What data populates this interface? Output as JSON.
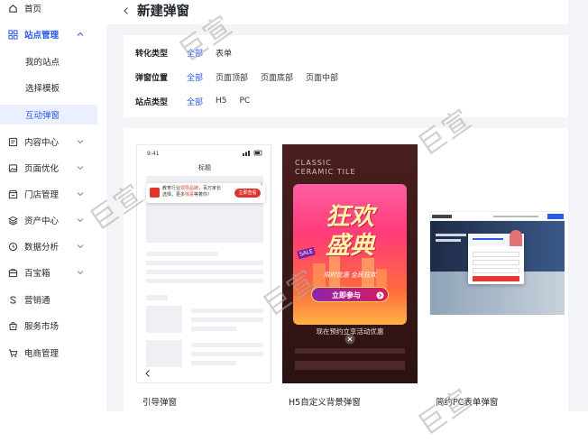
{
  "sidebar": {
    "items": [
      {
        "label": "首页",
        "icon": "home-icon"
      },
      {
        "label": "站点管理",
        "icon": "grid-icon"
      },
      {
        "label": "内容中心",
        "icon": "content-icon"
      },
      {
        "label": "页面优化",
        "icon": "image-icon"
      },
      {
        "label": "门店管理",
        "icon": "store-icon"
      },
      {
        "label": "资产中心",
        "icon": "layers-icon"
      },
      {
        "label": "数据分析",
        "icon": "clock-icon"
      },
      {
        "label": "百宝箱",
        "icon": "toolbox-icon"
      },
      {
        "label": "营销通",
        "icon": "marketing-icon"
      },
      {
        "label": "服务市场",
        "icon": "bag-icon"
      },
      {
        "label": "电商管理",
        "icon": "cart-icon"
      }
    ],
    "sub_items": [
      {
        "label": "我的站点"
      },
      {
        "label": "选择模板"
      },
      {
        "label": "互动弹窗"
      }
    ]
  },
  "header": {
    "title": "新建弹窗"
  },
  "filters": {
    "conversion": {
      "label": "转化类型",
      "options": [
        "全部",
        "表单"
      ]
    },
    "position": {
      "label": "弹窗位置",
      "options": [
        "全部",
        "页面顶部",
        "页面底部",
        "页面中部"
      ]
    },
    "site": {
      "label": "站点类型",
      "options": [
        "全部",
        "H5",
        "PC"
      ]
    }
  },
  "templates": [
    {
      "caption": "引导弹窗",
      "phone_time": "9:41",
      "phone_title": "标题",
      "banner_text_1": "教育行业",
      "banner_highlight_1": "领导品牌",
      "banner_text_2": "，百万家长",
      "banner_text_3": "选择，更多",
      "banner_highlight_2": "惊喜",
      "banner_text_4": "等着你！",
      "banner_button": "立即查看"
    },
    {
      "caption": "H5自定义背景弹窗",
      "bg_line_1": "CLASSIC",
      "bg_line_2": "CERAMIC TILE",
      "headline_1": "狂欢",
      "headline_2": "盛典",
      "sale_tag": "SALE",
      "ribbon_text": "限时优惠 全民狂欢",
      "cta": "立即参与",
      "footer_text": "现在预约立享活动优惠"
    },
    {
      "caption": "简约PC表单弹窗"
    }
  ],
  "colors": {
    "accent": "#2b5aed",
    "promo_red": "#d52b2b",
    "dark_bg": "#3a1a1a"
  },
  "watermark": "巨宣"
}
